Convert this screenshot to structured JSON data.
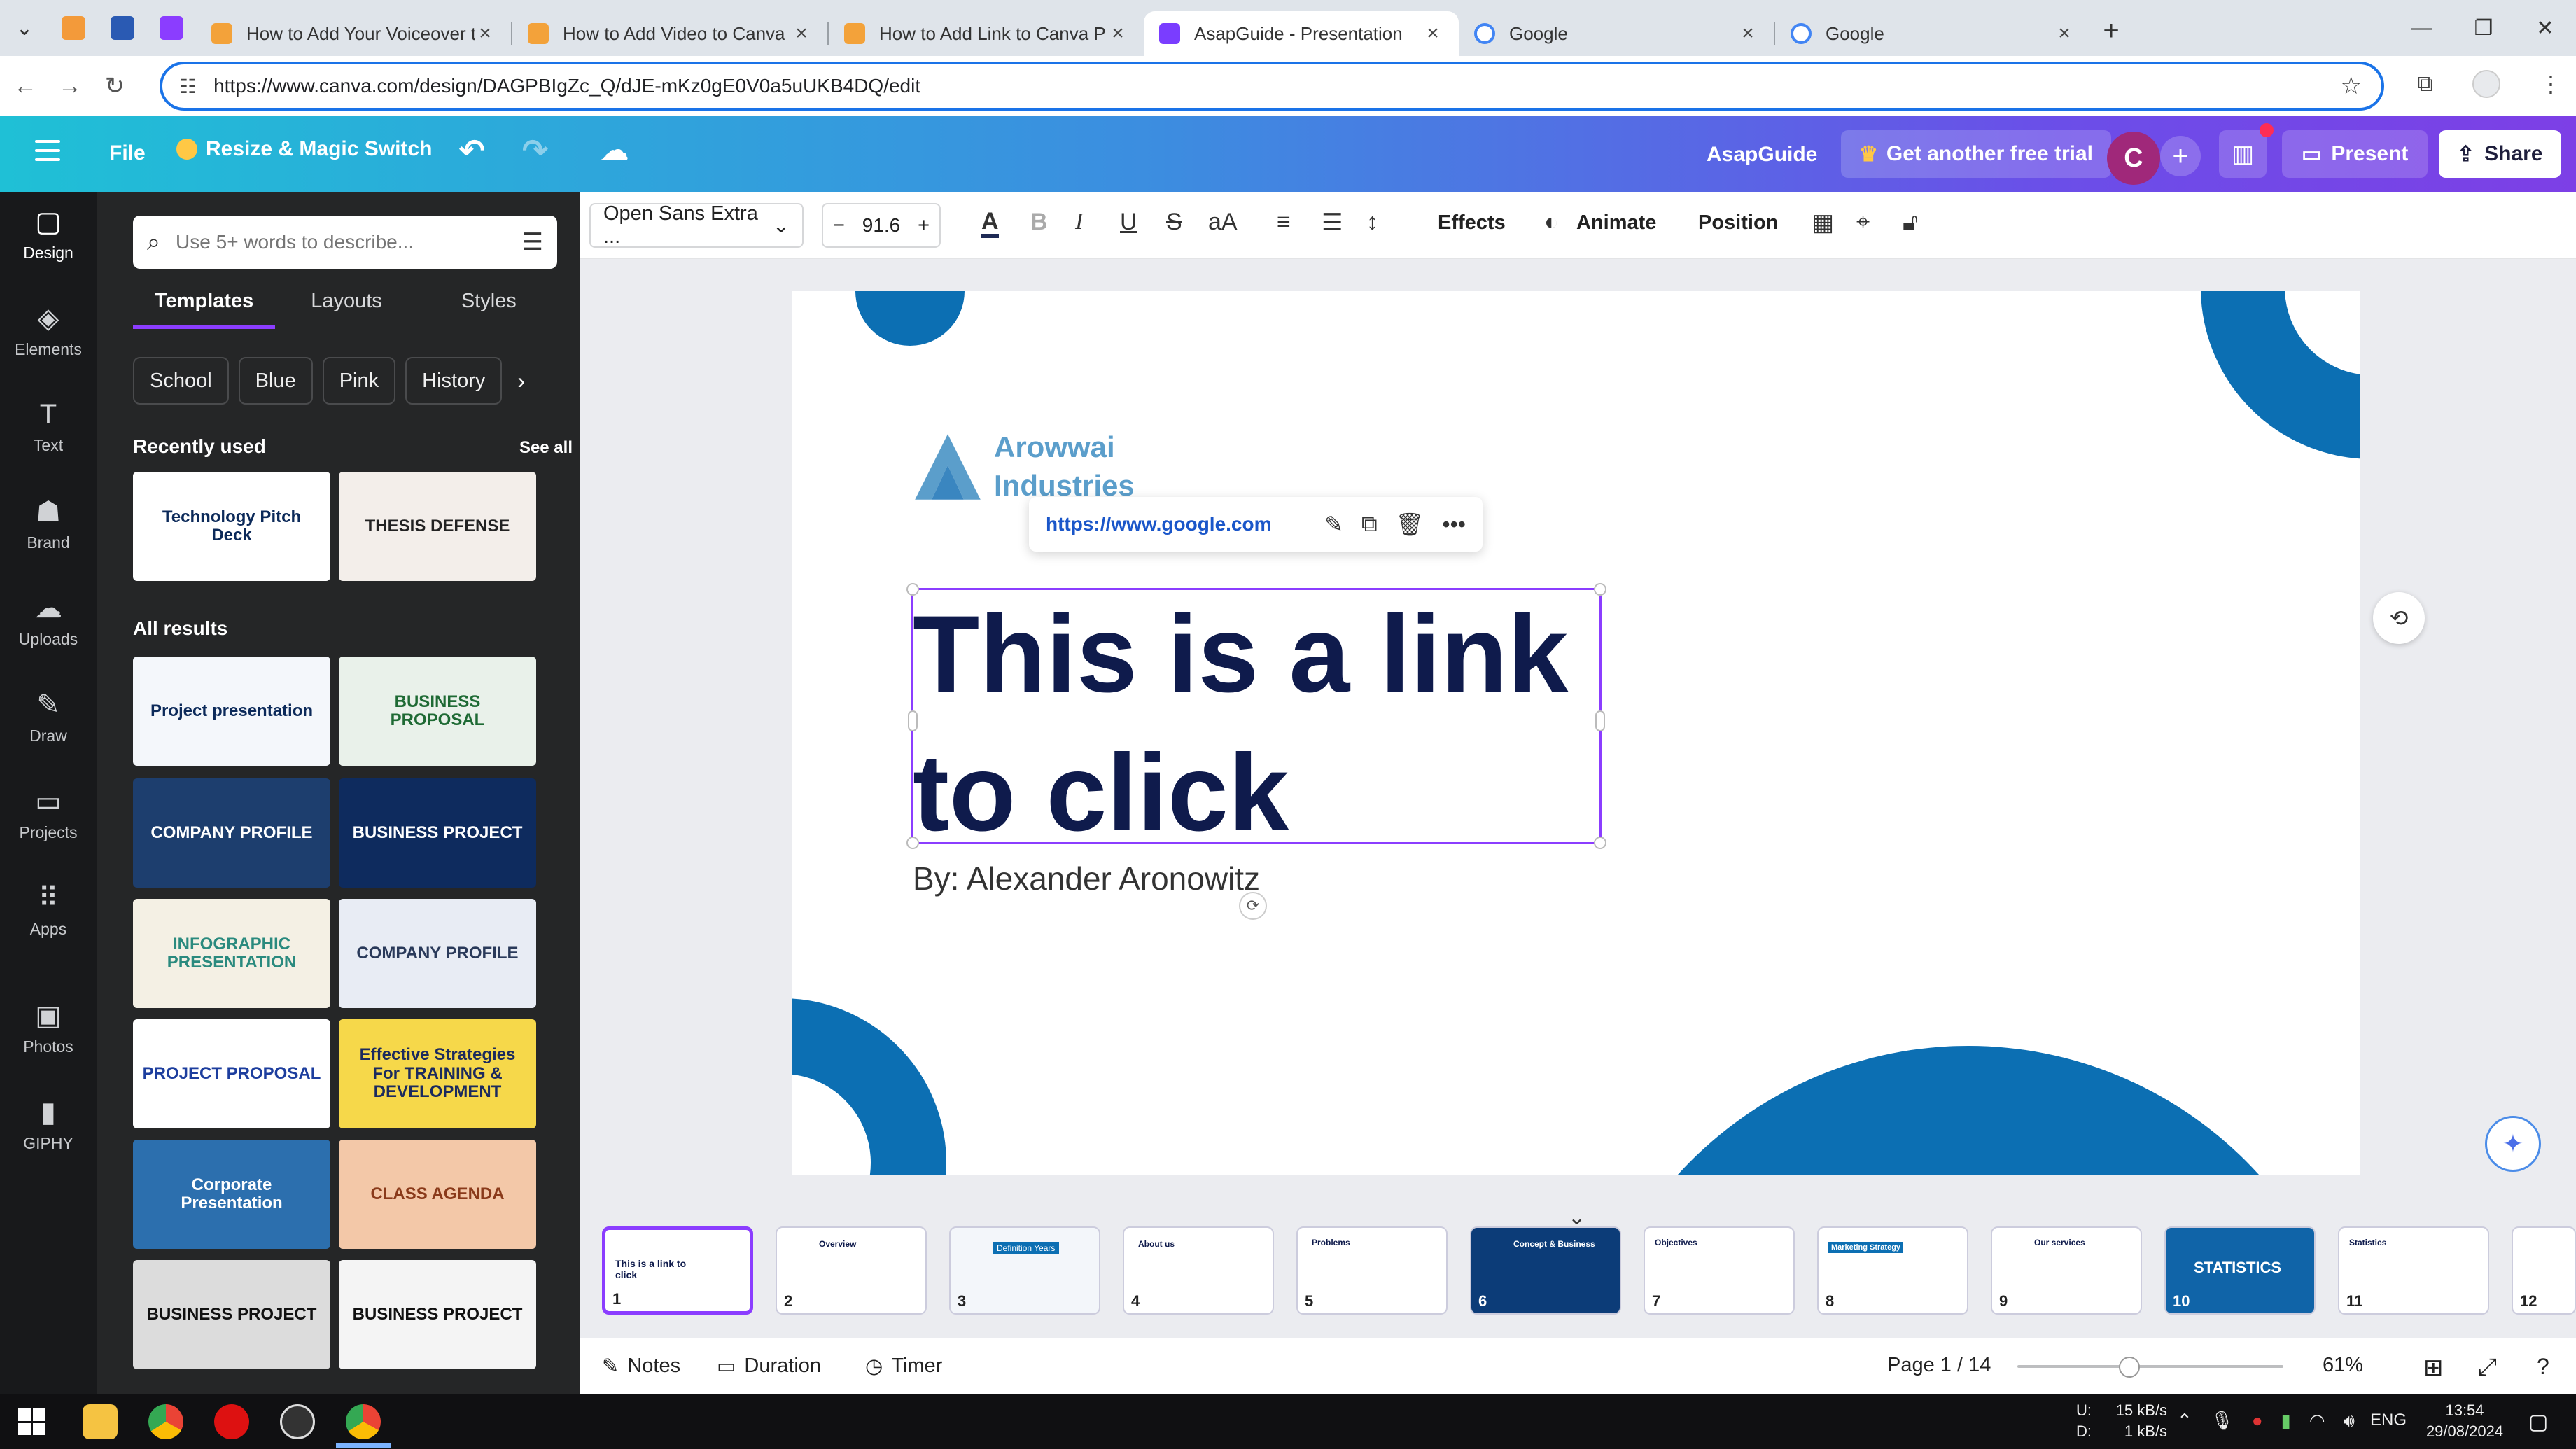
{
  "browser": {
    "tabs": [
      {
        "title": "How to Add Your Voiceover to",
        "active": false
      },
      {
        "title": "How to Add Video to Canva Pr",
        "active": false
      },
      {
        "title": "How to Add Link to Canva Pres",
        "active": false
      },
      {
        "title": "AsapGuide - Presentation",
        "active": true
      },
      {
        "title": "Google",
        "active": false
      },
      {
        "title": "Google",
        "active": false
      }
    ],
    "url": "https://www.canva.com/design/DAGPBIgZc_Q/dJE-mKz0gE0V0a5uUKB4DQ/edit"
  },
  "header": {
    "file": "File",
    "resize": "Resize & Magic Switch",
    "team": "AsapGuide",
    "trial": "Get another free trial",
    "avatar_letter": "C",
    "present": "Present",
    "share": "Share",
    "gradient_start": "#1fc0d6",
    "gradient_end": "#7d3fe6"
  },
  "rail": [
    {
      "label": "Design",
      "icon": "design-icon",
      "glyph": "▢",
      "active": true
    },
    {
      "label": "Elements",
      "icon": "elements-icon",
      "glyph": "◈",
      "active": false
    },
    {
      "label": "Text",
      "icon": "text-icon",
      "glyph": "T",
      "active": false
    },
    {
      "label": "Brand",
      "icon": "brand-icon",
      "glyph": "☗",
      "active": false
    },
    {
      "label": "Uploads",
      "icon": "uploads-icon",
      "glyph": "☁",
      "active": false
    },
    {
      "label": "Draw",
      "icon": "draw-icon",
      "glyph": "✎",
      "active": false
    },
    {
      "label": "Projects",
      "icon": "projects-icon",
      "glyph": "▭",
      "active": false
    },
    {
      "label": "Apps",
      "icon": "apps-icon",
      "glyph": "⠿",
      "active": false
    },
    {
      "label": "Photos",
      "icon": "photos-icon",
      "glyph": "▣",
      "active": false
    },
    {
      "label": "GIPHY",
      "icon": "giphy-icon",
      "glyph": "▮",
      "active": false
    }
  ],
  "panel": {
    "search_placeholder": "Use 5+ words to describe...",
    "tabs": [
      "Templates",
      "Layouts",
      "Styles"
    ],
    "chips": [
      "School",
      "Blue",
      "Pink",
      "History"
    ],
    "recently_used": "Recently used",
    "see_all": "See all",
    "all_results": "All results",
    "recent_thumbs": [
      {
        "text": "Technology Pitch Deck",
        "bg": "#ffffff",
        "fg": "#0c2a5a"
      },
      {
        "text": "THESIS DEFENSE",
        "bg": "#f3eeea",
        "fg": "#222222"
      }
    ],
    "result_thumbs": [
      {
        "text": "Project presentation",
        "bg": "#f4f7fb",
        "fg": "#0c2a5a"
      },
      {
        "text": "BUSINESS PROPOSAL",
        "bg": "#e9f1ea",
        "fg": "#1e6a34"
      },
      {
        "text": "COMPANY PROFILE",
        "bg": "#1d3e6e",
        "fg": "#ffffff"
      },
      {
        "text": "BUSINESS PROJECT",
        "bg": "#0e2b5e",
        "fg": "#ffffff"
      },
      {
        "text": "INFOGRAPHIC PRESENTATION",
        "bg": "#f4f0e4",
        "fg": "#2a8a7e"
      },
      {
        "text": "COMPANY PROFILE",
        "bg": "#e8ecf4",
        "fg": "#2a3a5a"
      },
      {
        "text": "PROJECT PROPOSAL",
        "bg": "#ffffff",
        "fg": "#1d3e9e"
      },
      {
        "text": "Effective Strategies For TRAINING & DEVELOPMENT",
        "bg": "#f6d84a",
        "fg": "#1b2a5e"
      },
      {
        "text": "Corporate Presentation",
        "bg": "#2c6fae",
        "fg": "#ffffff"
      },
      {
        "text": "CLASS AGENDA",
        "bg": "#f3c8a8",
        "fg": "#8a3a1a"
      },
      {
        "text": "BUSINESS PROJECT",
        "bg": "#dcdcdc",
        "fg": "#111111"
      },
      {
        "text": "BUSINESS PROJECT",
        "bg": "#f4f4f4",
        "fg": "#111111"
      }
    ]
  },
  "toolbar": {
    "font": "Open Sans Extra ...",
    "size": "91.6",
    "effects": "Effects",
    "animate": "Animate",
    "position": "Position"
  },
  "slide": {
    "company_line1": "Arowwai",
    "company_line2": "Industries",
    "title_line1": "This is a link",
    "title_line2": "to click",
    "byline": "By: Alexander Aronowitz",
    "link_url": "https://www.google.com",
    "accent": "#0c6fb3",
    "title_color": "#0f1b4c"
  },
  "filmstrip": {
    "pages": [
      {
        "num": "1",
        "label": "This is a link to click",
        "bg": "#ffffff",
        "dark": false
      },
      {
        "num": "2",
        "label": "Overview",
        "bg": "#ffffff",
        "dark": false
      },
      {
        "num": "3",
        "label": "Definition Years",
        "bg": "#f3f6fa",
        "dark": false
      },
      {
        "num": "4",
        "label": "About us",
        "bg": "#ffffff",
        "dark": false
      },
      {
        "num": "5",
        "label": "Problems",
        "bg": "#ffffff",
        "dark": false
      },
      {
        "num": "6",
        "label": "Concept & Business",
        "bg": "#0c3c78",
        "dark": true
      },
      {
        "num": "7",
        "label": "Objectives",
        "bg": "#ffffff",
        "dark": false
      },
      {
        "num": "8",
        "label": "Marketing Strategy",
        "bg": "#ffffff",
        "dark": false
      },
      {
        "num": "9",
        "label": "Our services",
        "bg": "#ffffff",
        "dark": false
      },
      {
        "num": "10",
        "label": "STATISTICS",
        "bg": "#1064a8",
        "dark": true
      },
      {
        "num": "11",
        "label": "Statistics",
        "bg": "#ffffff",
        "dark": false
      },
      {
        "num": "12",
        "label": "",
        "bg": "#ffffff",
        "dark": false
      }
    ]
  },
  "bottom": {
    "notes": "Notes",
    "duration": "Duration",
    "timer": "Timer",
    "page": "Page 1 / 14",
    "zoom": "61%",
    "zoom_fraction": 0.42
  },
  "taskbar": {
    "net_up": "15 kB/s",
    "net_down": "1 kB/s",
    "net_up_label": "U:",
    "net_down_label": "D:",
    "lang": "ENG",
    "time": "13:54",
    "date": "29/08/2024"
  }
}
